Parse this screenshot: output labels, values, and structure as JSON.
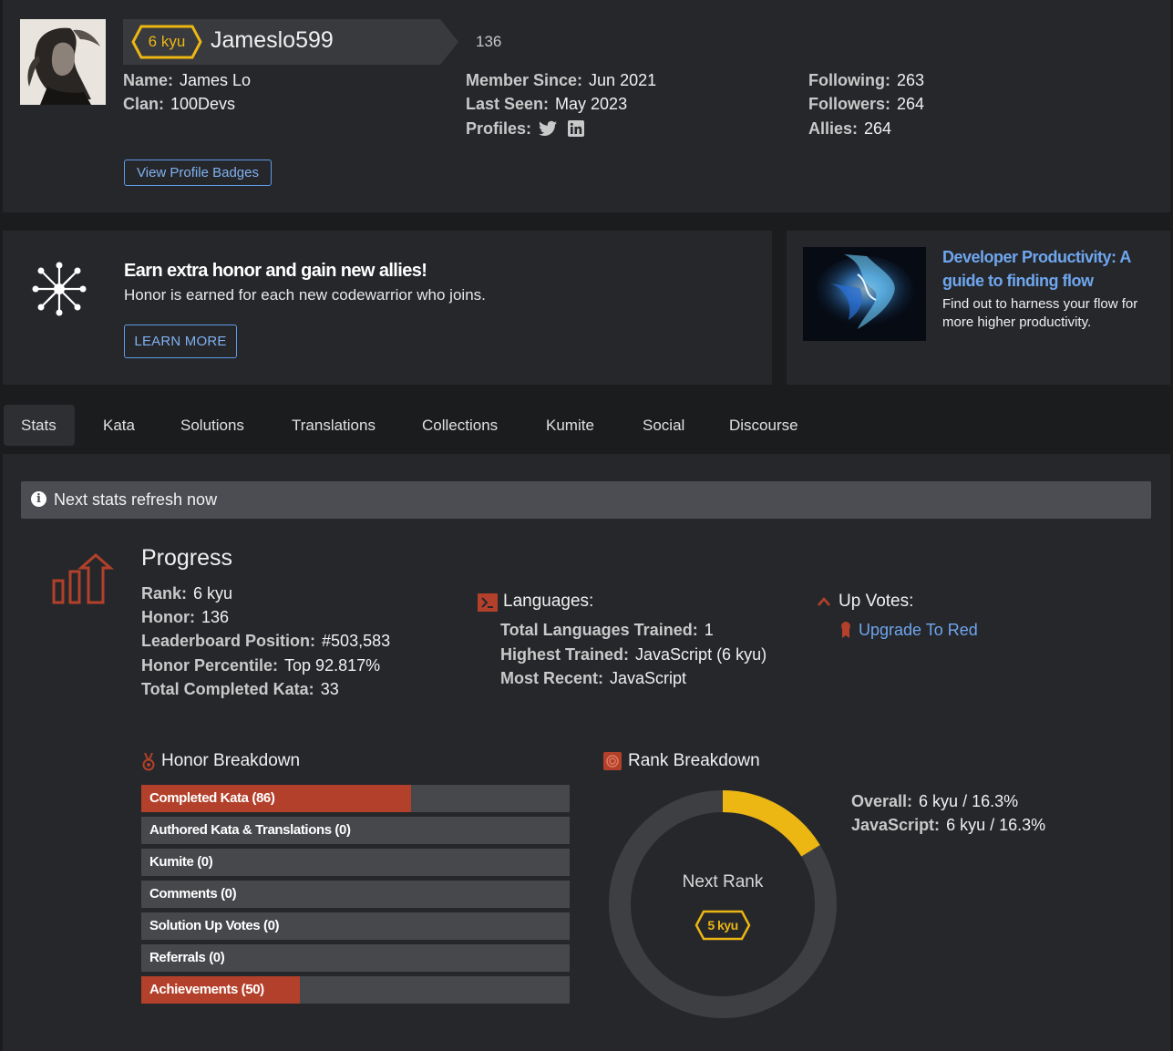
{
  "profile": {
    "rank_badge": "6 kyu",
    "username": "Jameslo599",
    "honor": "136",
    "name_label": "Name:",
    "name": "James Lo",
    "clan_label": "Clan:",
    "clan": "100Devs",
    "member_since_label": "Member Since:",
    "member_since": "Jun 2021",
    "last_seen_label": "Last Seen:",
    "last_seen": "May 2023",
    "profiles_label": "Profiles:",
    "following_label": "Following:",
    "following": "263",
    "followers_label": "Followers:",
    "followers": "264",
    "allies_label": "Allies:",
    "allies": "264",
    "view_badges_button": "View Profile Badges"
  },
  "referral": {
    "title": "Earn extra honor and gain new allies!",
    "subtitle": "Honor is earned for each new codewarrior who joins.",
    "button": "LEARN MORE"
  },
  "ad": {
    "title": "Developer Productivity: A guide to finding flow",
    "text": "Find out to harness your flow for more higher productivity."
  },
  "tabs": [
    "Stats",
    "Kata",
    "Solutions",
    "Translations",
    "Collections",
    "Kumite",
    "Social",
    "Discourse"
  ],
  "refresh_notice": "Next stats refresh now",
  "progress": {
    "title": "Progress",
    "rank_label": "Rank:",
    "rank": "6 kyu",
    "honor_label": "Honor:",
    "honor": "136",
    "leaderboard_label": "Leaderboard Position:",
    "leaderboard": "#503,583",
    "percentile_label": "Honor Percentile:",
    "percentile": "Top 92.817%",
    "completed_label": "Total Completed Kata:",
    "completed": "33"
  },
  "languages": {
    "title": "Languages:",
    "total_label": "Total Languages Trained:",
    "total": "1",
    "highest_label": "Highest Trained:",
    "highest": "JavaScript (6 kyu)",
    "recent_label": "Most Recent:",
    "recent": "JavaScript"
  },
  "upvotes": {
    "title": "Up Votes:",
    "link": "Upgrade To Red"
  },
  "honor_breakdown": {
    "title": "Honor Breakdown",
    "items": [
      {
        "label": "Completed Kata (86)",
        "fraction": 0.63
      },
      {
        "label": "Authored Kata & Translations (0)",
        "fraction": 0
      },
      {
        "label": "Kumite (0)",
        "fraction": 0
      },
      {
        "label": "Comments (0)",
        "fraction": 0
      },
      {
        "label": "Solution Up Votes (0)",
        "fraction": 0
      },
      {
        "label": "Referrals (0)",
        "fraction": 0
      },
      {
        "label": "Achievements (50)",
        "fraction": 0.37
      }
    ]
  },
  "rank_breakdown": {
    "title": "Rank Breakdown",
    "overall_label": "Overall:",
    "overall": "6 kyu / 16.3%",
    "javascript_label": "JavaScript:",
    "javascript": "6 kyu / 16.3%",
    "next_rank_label": "Next Rank",
    "next_rank": "5 kyu",
    "progress_fraction": 0.163
  },
  "colors": {
    "accent_red": "#b3402a",
    "rank_yellow": "#ecb613",
    "link_blue": "#6ea6ee",
    "donut_track": "#3d3f43"
  }
}
